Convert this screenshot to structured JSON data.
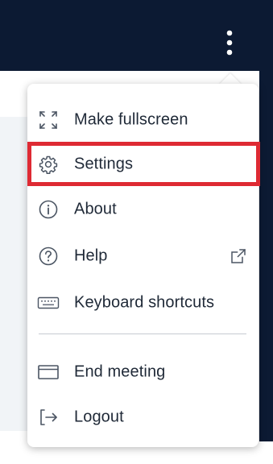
{
  "header": {
    "more_options_icon": "kebab-vertical-icon"
  },
  "menu": {
    "items": [
      {
        "label": "Make fullscreen",
        "icon": "fullscreen-icon"
      },
      {
        "label": "Settings",
        "icon": "gear-icon"
      },
      {
        "label": "About",
        "icon": "info-icon"
      },
      {
        "label": "Help",
        "icon": "help-icon",
        "trailing_icon": "external-link-icon"
      },
      {
        "label": "Keyboard shortcuts",
        "icon": "keyboard-icon"
      },
      {
        "label": "End meeting",
        "icon": "window-icon"
      },
      {
        "label": "Logout",
        "icon": "logout-icon"
      }
    ]
  },
  "colors": {
    "header_background": "#0c1a33",
    "menu_text": "#1f2937",
    "highlight_border": "#de2a33"
  }
}
